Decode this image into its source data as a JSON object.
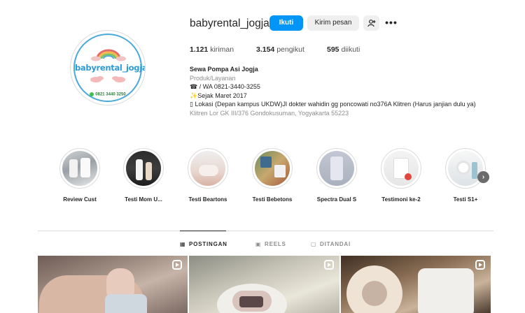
{
  "profile": {
    "username": "babyrental_jogja",
    "logo_text": "babyrental_jogja",
    "logo_phone": "0821 3440 3250"
  },
  "actions": {
    "follow": "Ikuti",
    "message": "Kirim pesan",
    "more": "•••"
  },
  "stats": {
    "posts_count": "1.121",
    "posts_label": "kiriman",
    "followers_count": "3.154",
    "followers_label": "pengikut",
    "following_count": "595",
    "following_label": "diikuti"
  },
  "bio": {
    "name": "Sewa Pompa Asi Jogja",
    "category": "Produk/Layanan",
    "line1": "☎ / WA 0821-3440-3255",
    "line2": "✨Sejak Maret 2017",
    "line3": "▯ Lokasi (Depan kampus UKDW)Jl dokter wahidin gg poncowati no376A Klitren (Harus janjian dulu ya)",
    "address": "Klitren Lor GK III/376 Gondokusuman, Yogyakarta 55223"
  },
  "highlights": [
    {
      "label": "Review Cust"
    },
    {
      "label": "Testi Mom U..."
    },
    {
      "label": "Testi Beartons"
    },
    {
      "label": "Testi Bebetons"
    },
    {
      "label": "Spectra Dual S"
    },
    {
      "label": "Testimoni ke-2"
    },
    {
      "label": "Testi S1+"
    }
  ],
  "tabs": {
    "posts": "POSTINGAN",
    "reels": "REELS",
    "tagged": "DITANDAI"
  },
  "colors": {
    "accent": "#0095f6",
    "text": "#262626",
    "muted": "#8e8e8e"
  }
}
